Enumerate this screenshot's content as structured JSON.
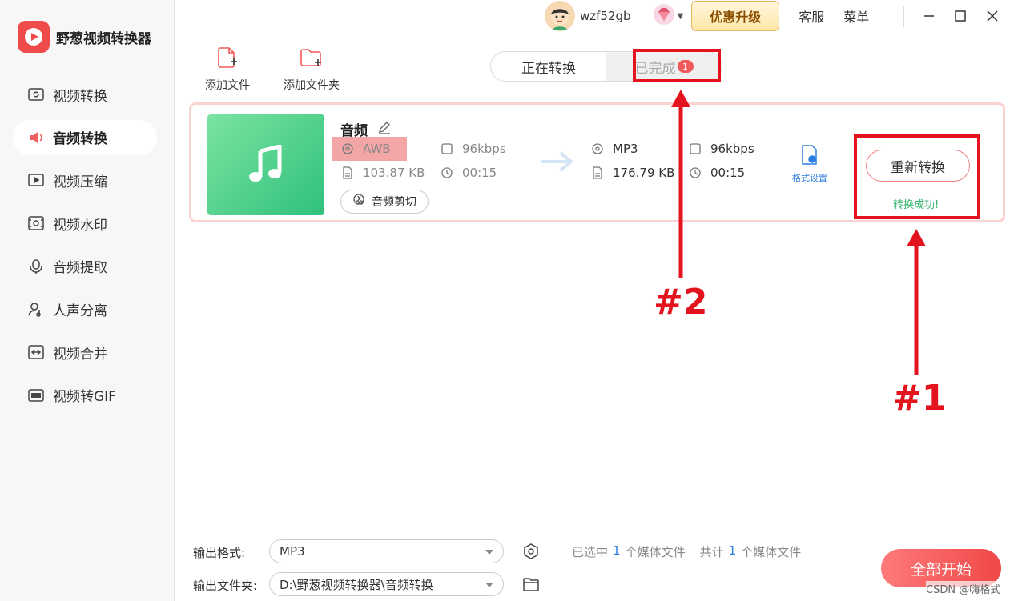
{
  "app": {
    "title": "野葱视频转换器"
  },
  "sidebar": {
    "items": [
      {
        "label": "视频转换",
        "icon": "video-convert-icon"
      },
      {
        "label": "音频转换",
        "icon": "audio-convert-icon",
        "active": true
      },
      {
        "label": "视频压缩",
        "icon": "video-compress-icon"
      },
      {
        "label": "视频水印",
        "icon": "watermark-icon"
      },
      {
        "label": "音频提取",
        "icon": "audio-extract-icon"
      },
      {
        "label": "人声分离",
        "icon": "vocal-separate-icon"
      },
      {
        "label": "视频合并",
        "icon": "video-merge-icon"
      },
      {
        "label": "视频转GIF",
        "icon": "gif-icon"
      }
    ]
  },
  "header": {
    "username": "wzf52gb",
    "upgrade_label": "优惠升级",
    "service_label": "客服",
    "menu_label": "菜单"
  },
  "toolbar": {
    "add_file_label": "添加文件",
    "add_folder_label": "添加文件夹"
  },
  "tabs": {
    "converting_label": "正在转换",
    "completed_label": "已完成",
    "completed_count": "1"
  },
  "file": {
    "name": "音频",
    "source": {
      "format": "AWB",
      "bitrate": "96kbps",
      "size": "103.87 KB",
      "duration": "00:15"
    },
    "target": {
      "format": "MP3",
      "bitrate": "96kbps",
      "size": "176.79 KB",
      "duration": "00:15"
    },
    "trim_label": "音频剪切",
    "format_settings_label": "格式设置",
    "reconvert_label": "重新转换",
    "status_text": "转换成功!"
  },
  "annotations": {
    "label_1": "#1",
    "label_2": "#2",
    "color": "#e3141e"
  },
  "footer": {
    "output_format_label": "输出格式:",
    "output_format_value": "MP3",
    "output_folder_label": "输出文件夹:",
    "output_folder_value": "D:\\野葱视频转换器\\音频转换",
    "selected_prefix": "已选中",
    "selected_count": "1",
    "selected_suffix": "个媒体文件",
    "total_prefix": "共计",
    "total_count": "1",
    "total_suffix": "个媒体文件",
    "start_all_label": "全部开始"
  },
  "watermark": "CSDN @嗨格式"
}
